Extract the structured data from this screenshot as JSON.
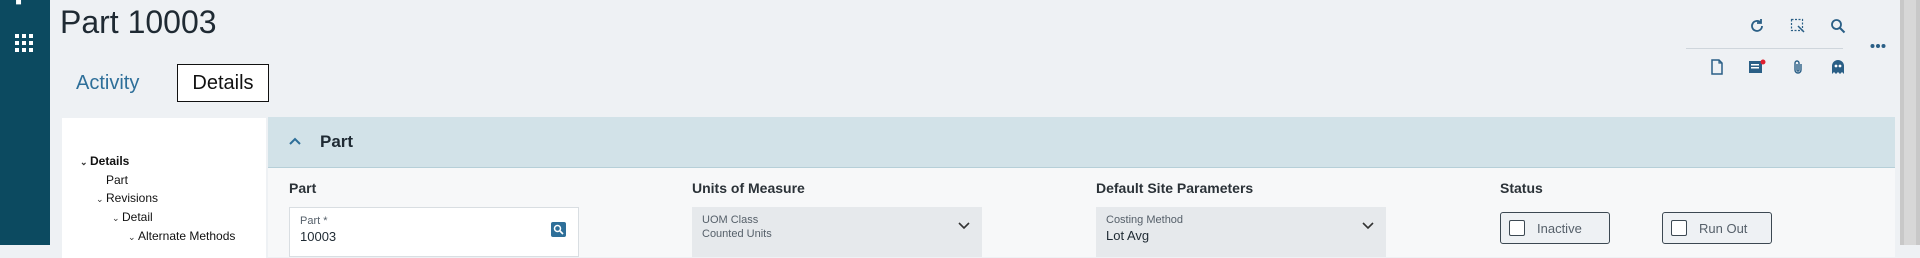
{
  "page": {
    "title": "Part 10003"
  },
  "tabs": [
    {
      "label": "Activity"
    },
    {
      "label": "Details"
    }
  ],
  "toolbar": {
    "row1": [
      "refresh-icon",
      "select-region-icon",
      "search-icon"
    ],
    "more": "more-icon",
    "row2": [
      "document-icon",
      "notes-icon",
      "attachment-icon",
      "ghost-icon"
    ]
  },
  "tree": {
    "items": [
      {
        "label": "Details",
        "expanded": true
      },
      {
        "label": "Part"
      },
      {
        "label": "Revisions",
        "expanded": true
      },
      {
        "label": "Detail",
        "expanded": true
      },
      {
        "label": "Alternate Methods",
        "expanded": true
      }
    ]
  },
  "panel": {
    "title": "Part",
    "sections": {
      "part": "Part",
      "uom": "Units of Measure",
      "site": "Default Site Parameters",
      "status": "Status"
    },
    "fields": {
      "part": {
        "label": "Part *",
        "value": "10003"
      },
      "uom": {
        "label": "UOM Class",
        "value": "Counted Units"
      },
      "costing": {
        "label": "Costing Method",
        "value": "Lot Avg"
      }
    },
    "status": {
      "inactive": "Inactive",
      "runout": "Run Out"
    }
  },
  "colors": {
    "rail": "#0c4a60",
    "accent": "#2e6f99",
    "panel_header": "#d2e2e8"
  }
}
